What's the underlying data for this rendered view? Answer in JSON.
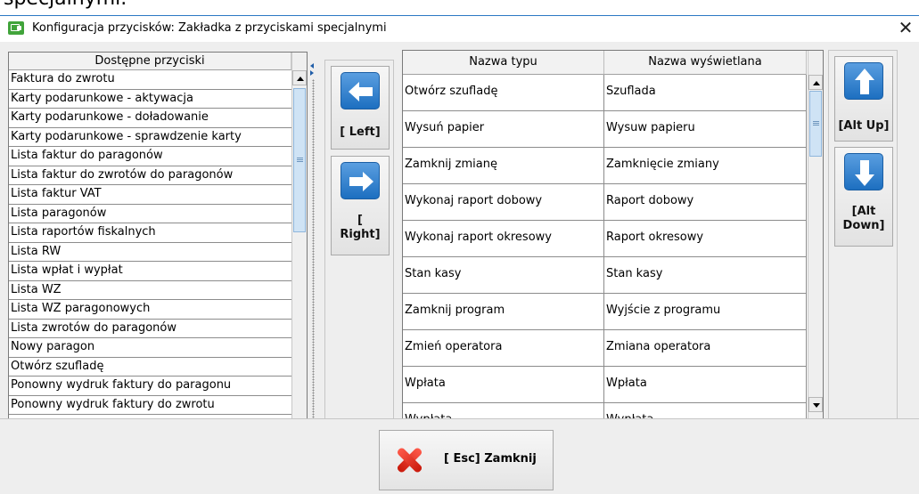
{
  "background_fragment": "specjalnymi.",
  "window": {
    "title": "Konfiguracja przycisków: Zakładka z przyciskami specjalnymi",
    "close_glyph": "✕"
  },
  "available_list": {
    "header": "Dostępne przyciski",
    "items": [
      "Faktura do zwrotu",
      "Karty podarunkowe - aktywacja",
      "Karty podarunkowe - doładowanie",
      "Karty podarunkowe - sprawdzenie karty",
      "Lista faktur do paragonów",
      "Lista faktur do zwrotów do paragonów",
      "Lista faktur VAT",
      "Lista paragonów",
      "Lista raportów fiskalnych",
      "Lista RW",
      "Lista wpłat i wypłat",
      "Lista WZ",
      "Lista WZ paragonowych",
      "Lista zwrotów do paragonów",
      "Nowy paragon",
      "Otwórz szufladę",
      "Ponowny wydruk faktury do paragonu",
      "Ponowny wydruk faktury do zwrotu"
    ]
  },
  "move_buttons": {
    "left_label": "[ Left]",
    "right_label_1": "[",
    "right_label_2": "Right]",
    "left_icon": "arrow-left-icon",
    "right_icon": "arrow-right-icon"
  },
  "selected_grid": {
    "columns": [
      "Nazwa typu",
      "Nazwa wyświetlana"
    ],
    "rows": [
      [
        "Otwórz szufladę",
        "Szuflada"
      ],
      [
        "Wysuń papier",
        "Wysuw papieru"
      ],
      [
        "Zamknij zmianę",
        "Zamknięcie zmiany"
      ],
      [
        "Wykonaj raport dobowy",
        "Raport dobowy"
      ],
      [
        "Wykonaj raport okresowy",
        "Raport okresowy"
      ],
      [
        "Stan kasy",
        "Stan kasy"
      ],
      [
        "Zamknij program",
        "Wyjście z programu"
      ],
      [
        "Zmień operatora",
        "Zmiana operatora"
      ],
      [
        "Wpłata",
        "Wpłata"
      ],
      [
        "Wypłata",
        "Wypłata"
      ]
    ]
  },
  "order_buttons": {
    "up_label": "[Alt Up]",
    "down_label_1": "[Alt",
    "down_label_2": "Down]",
    "up_icon": "arrow-up-icon",
    "down_icon": "arrow-down-icon"
  },
  "close_button": {
    "label": "[ Esc] Zamknij",
    "icon": "red-x-icon"
  },
  "colors": {
    "accent_blue": "#1d6fc0",
    "close_red": "#d8261a",
    "app_icon_green": "#41a43b"
  }
}
